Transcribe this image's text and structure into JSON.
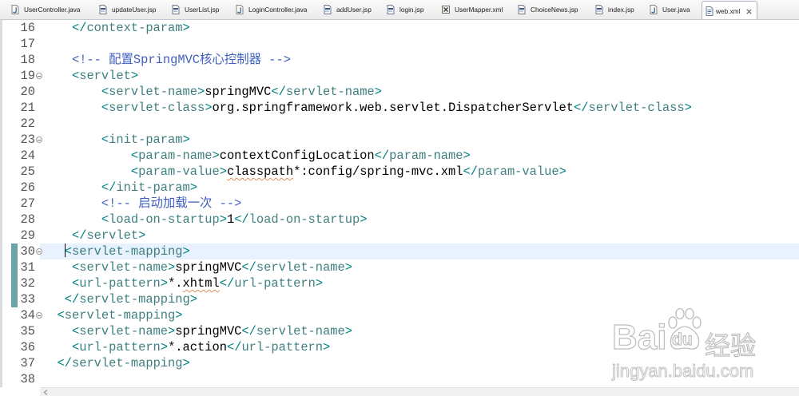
{
  "tabs": [
    {
      "label": "UserController.java",
      "icon": "java-file-icon"
    },
    {
      "label": "updateUser.jsp",
      "icon": "jsp-file-icon"
    },
    {
      "label": "UserList.jsp",
      "icon": "jsp-file-icon"
    },
    {
      "label": "LoginController.java",
      "icon": "java-file-icon"
    },
    {
      "label": "addUser.jsp",
      "icon": "jsp-file-icon"
    },
    {
      "label": "login.jsp",
      "icon": "jsp-file-icon"
    },
    {
      "label": "UserMapper.xml",
      "icon": "xml-file-icon"
    },
    {
      "label": "ChoiceNews.jsp",
      "icon": "jsp-file-icon"
    },
    {
      "label": "index.jsp",
      "icon": "jsp-file-icon"
    },
    {
      "label": "User.java",
      "icon": "java-file-icon"
    },
    {
      "label": "web.xml",
      "icon": "web-xml-file-icon",
      "active": true,
      "close_icon": "close-icon"
    }
  ],
  "editor": {
    "lines": [
      {
        "number": 16,
        "text": "    </context-param>"
      },
      {
        "number": 17,
        "text": ""
      },
      {
        "number": 18,
        "text": "    <!-- 配置SpringMVC核心控制器 -->"
      },
      {
        "number": 19,
        "text": "    <servlet>",
        "fold": true
      },
      {
        "number": 20,
        "text": "        <servlet-name>springMVC</servlet-name>"
      },
      {
        "number": 21,
        "text": "        <servlet-class>org.springframework.web.servlet.DispatcherServlet</servlet-class>"
      },
      {
        "number": 22,
        "text": ""
      },
      {
        "number": 23,
        "text": "        <init-param>",
        "fold": true
      },
      {
        "number": 24,
        "text": "            <param-name>contextConfigLocation</param-name>"
      },
      {
        "number": 25,
        "text": "            <param-value>classpath*:config/spring-mvc.xml</param-value>",
        "misspelled": "classpath"
      },
      {
        "number": 26,
        "text": "        </init-param>"
      },
      {
        "number": 27,
        "text": "        <!-- 启动加载一次 -->"
      },
      {
        "number": 28,
        "text": "        <load-on-startup>1</load-on-startup>"
      },
      {
        "number": 29,
        "text": "    </servlet>"
      },
      {
        "number": 30,
        "text": "   <servlet-mapping>",
        "fold": true,
        "changed": true,
        "current": true,
        "caret": true
      },
      {
        "number": 31,
        "text": "    <servlet-name>springMVC</servlet-name>",
        "changed": true
      },
      {
        "number": 32,
        "text": "    <url-pattern>*.xhtml</url-pattern>",
        "changed": true,
        "misspelled": "xhtml"
      },
      {
        "number": 33,
        "text": "   </servlet-mapping>",
        "changed": true
      },
      {
        "number": 34,
        "text": "  <servlet-mapping>",
        "fold": true
      },
      {
        "number": 35,
        "text": "    <servlet-name>springMVC</servlet-name>"
      },
      {
        "number": 36,
        "text": "    <url-pattern>*.action</url-pattern>"
      },
      {
        "number": 37,
        "text": "  </servlet-mapping>"
      },
      {
        "number": 38,
        "text": ""
      }
    ]
  },
  "colors": {
    "tag_name": "#3f7f7f",
    "tag_delimiter": "#008080",
    "comment": "#3f5fbf",
    "text": "#000000",
    "line_number": "#555555",
    "current_line": "#e8f2fe",
    "change_marker": "#6ba3a8",
    "spelling_underline": "#e0905a"
  },
  "watermark": {
    "brand_left": "Bai",
    "brand_icon": "paw-icon",
    "brand_right": "du",
    "product": "经验",
    "url": "jingyan.baidu.com"
  }
}
